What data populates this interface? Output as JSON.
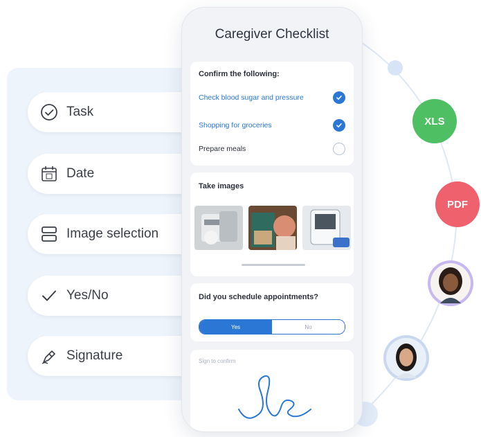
{
  "fields": [
    {
      "label": "Task",
      "icon": "check-circle-icon"
    },
    {
      "label": "Date",
      "icon": "calendar-icon"
    },
    {
      "label": "Image selection",
      "icon": "image-selection-icon"
    },
    {
      "label": "Yes/No",
      "icon": "checkmark-icon"
    },
    {
      "label": "Signature",
      "icon": "signature-icon"
    }
  ],
  "phone": {
    "title": "Caregiver Checklist",
    "confirm": {
      "heading": "Confirm the following:",
      "items": [
        {
          "label": "Check blood sugar and pressure",
          "checked": true
        },
        {
          "label": "Shopping for groceries",
          "checked": true
        },
        {
          "label": "Prepare meals",
          "checked": false
        }
      ]
    },
    "images": {
      "heading": "Take images",
      "thumbnails": [
        "medication-photo",
        "cabinet-photo",
        "monitor-photo"
      ]
    },
    "appointments": {
      "question": "Did you schedule appointments?",
      "yes_label": "Yes",
      "no_label": "No",
      "selected": "Yes"
    },
    "signature": {
      "placeholder": "Sign to confirm"
    }
  },
  "export_badges": [
    {
      "label": "XLS",
      "color": "#4fbf63"
    },
    {
      "label": "PDF",
      "color": "#f0616e"
    }
  ],
  "colors": {
    "accent": "#2a77d6",
    "panel": "#eef4fb",
    "avatar_ring": "#c8b8f0"
  }
}
